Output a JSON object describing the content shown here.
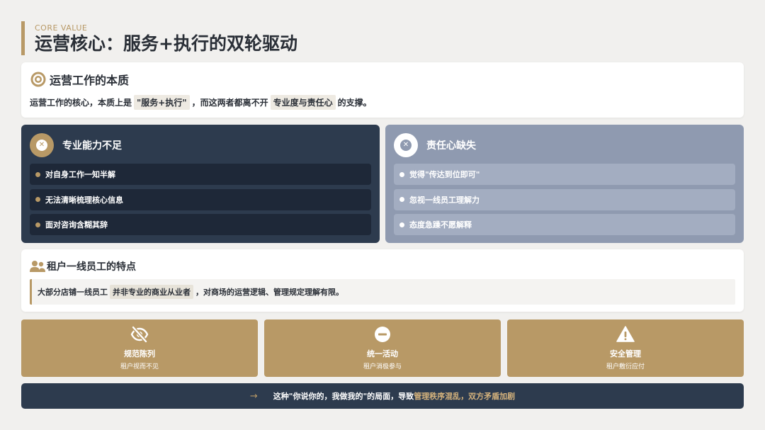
{
  "header": {
    "eyebrow": "CORE VALUE",
    "title": "运营核心：服务+执行的双轮驱动"
  },
  "essence": {
    "title": "运营工作的本质",
    "icon": "target-icon",
    "text_1": "运营工作的核心，本质上是",
    "highlight_1": "\"服务+执行\"",
    "text_2": "，而这两者都离不开",
    "highlight_2": "专业度与责任心",
    "text_3": "的支撑。"
  },
  "panels": [
    {
      "title": "专业能力不足",
      "icon": "x-circle-icon",
      "items": [
        "对自身工作一知半解",
        "无法清晰梳理核心信息",
        "面对咨询含糊其辞"
      ]
    },
    {
      "title": "责任心缺失",
      "icon": "x-circle-icon",
      "items": [
        "觉得\"传达到位即可\"",
        "忽视一线员工理解力",
        "态度急躁不愿解释"
      ]
    }
  ],
  "tenant": {
    "title": "租户一线员工的特点",
    "icon": "users-icon",
    "text_1": "大部分店铺一线员工",
    "highlight": "并非专业的商业从业者",
    "text_2": "，对商场的运营逻辑、管理规定理解有限。"
  },
  "tiles": [
    {
      "icon": "eye-slash-icon",
      "label": "规范陈列",
      "sub": "租户视而不见"
    },
    {
      "icon": "minus-circle-icon",
      "label": "统一活动",
      "sub": "租户消极参与"
    },
    {
      "icon": "warning-triangle-icon",
      "label": "安全管理",
      "sub": "租户敷衍应付"
    }
  ],
  "footer": {
    "arrow": "→",
    "text": "这种\"你说你的，我做我的\"的局面，导致",
    "accent": "管理秩序混乱，双方矛盾加剧"
  },
  "colors": {
    "gold": "#b89966",
    "navy": "#2d3b4e",
    "slate": "#8f9ab0",
    "background": "#f1f0ee"
  }
}
